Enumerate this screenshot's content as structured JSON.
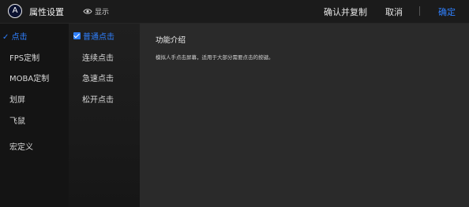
{
  "header": {
    "badge_letter": "A",
    "title": "属性设置",
    "show_label": "显示",
    "confirm_copy_label": "确认并复制",
    "cancel_label": "取消",
    "confirm_label": "确定"
  },
  "categories": {
    "active_check": "✓",
    "items": [
      {
        "label": "点击"
      },
      {
        "label": "FPS定制"
      },
      {
        "label": "MOBA定制"
      },
      {
        "label": "划屏"
      },
      {
        "label": "飞鼠"
      },
      {
        "label": "宏定义"
      }
    ]
  },
  "subtypes": {
    "items": [
      {
        "label": "普通点击"
      },
      {
        "label": "连续点击"
      },
      {
        "label": "急速点击"
      },
      {
        "label": "松开点击"
      }
    ]
  },
  "detail": {
    "heading": "功能介绍",
    "description": "模拟人手点击屏幕，适用于大部分需要点击的按键。"
  },
  "colors": {
    "accent": "#2f80ff",
    "panel_bg": "#2a2a2a",
    "topbar_bg": "#1b1b1b"
  }
}
